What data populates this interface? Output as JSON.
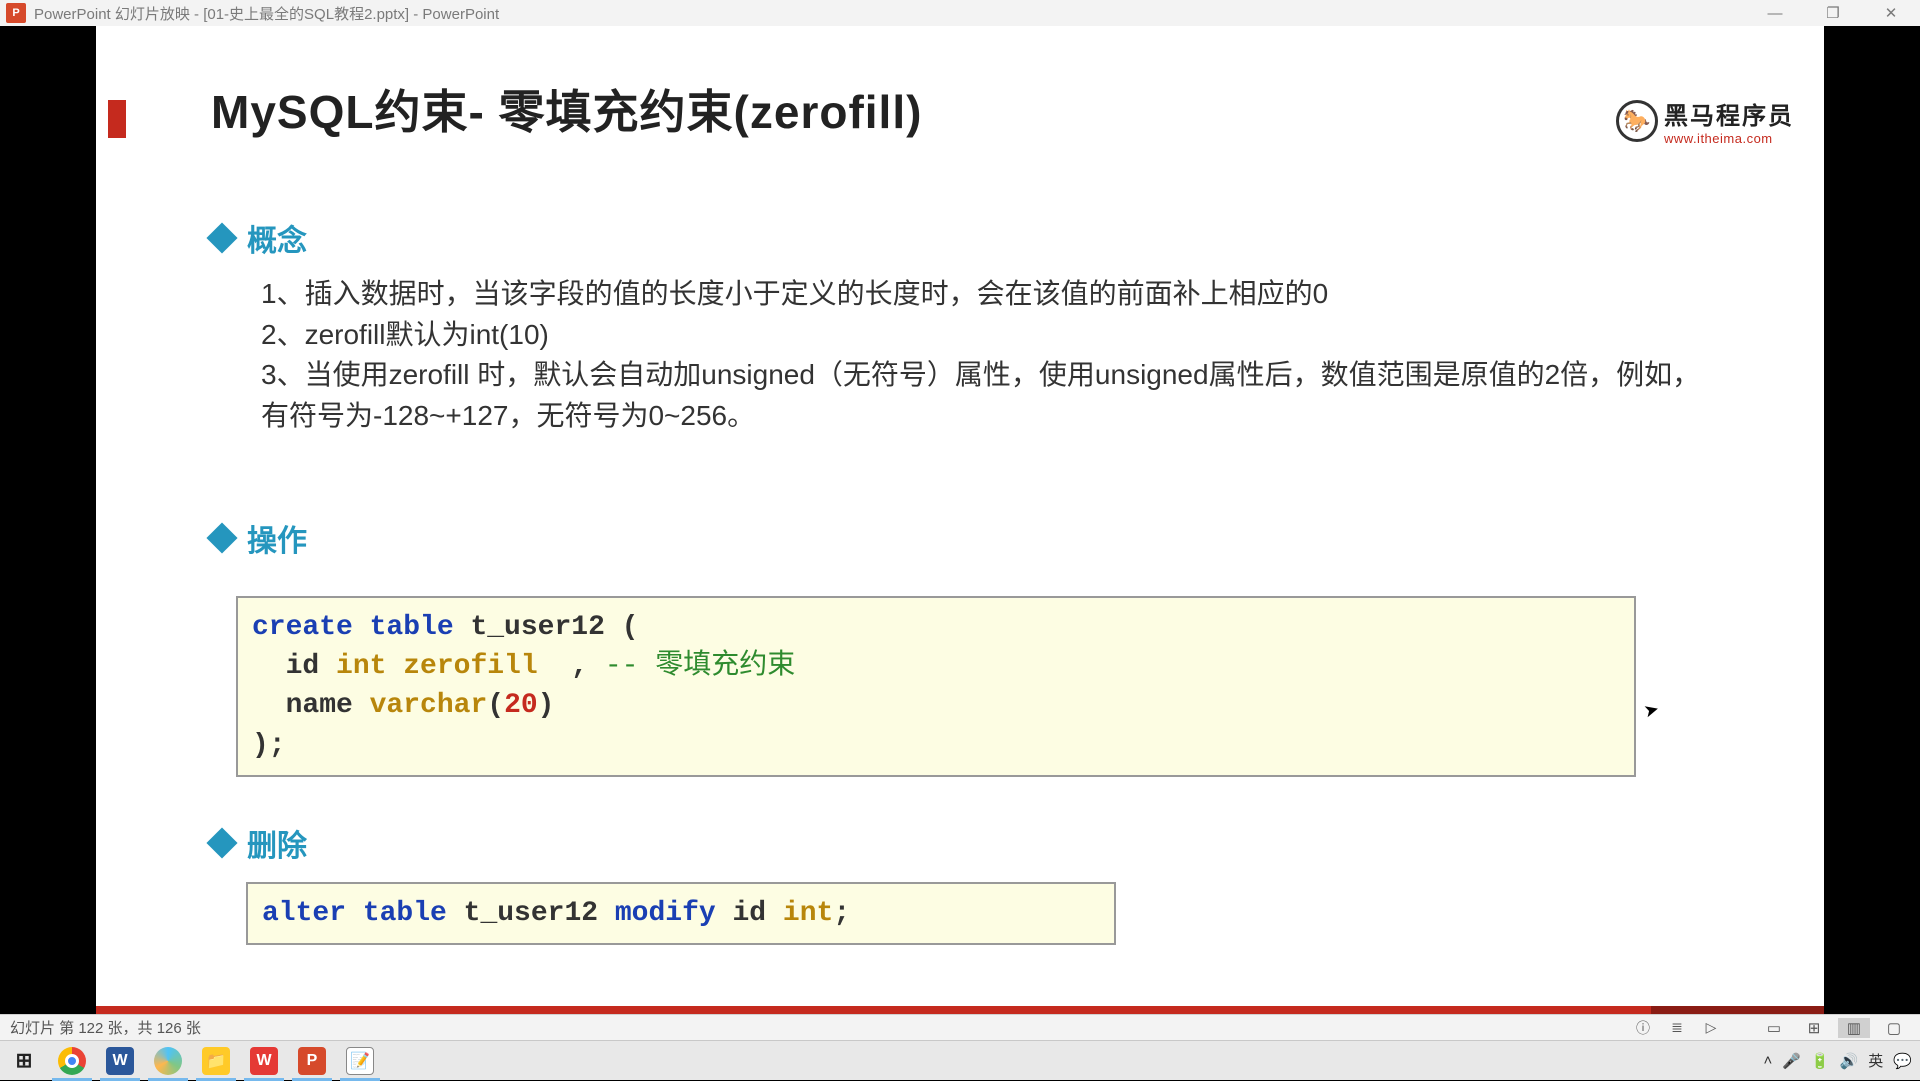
{
  "window": {
    "title": "PowerPoint 幻灯片放映 - [01-史上最全的SQL教程2.pptx] - PowerPoint",
    "minimize": "—",
    "maximize": "❐",
    "close": "✕"
  },
  "slide": {
    "title": "MySQL约束- 零填充约束(zerofill)",
    "logo": {
      "cn": "黑马程序员",
      "url": "www.itheima.com",
      "glyph": "🐎"
    },
    "section1": "概念",
    "concept_lines": [
      "1、插入数据时，当该字段的值的长度小于定义的长度时，会在该值的前面补上相应的0",
      "2、zerofill默认为int(10)",
      "3、当使用zerofill 时，默认会自动加unsigned（无符号）属性，使用unsigned属性后，数值范围是原值的2倍，例如，有符号为-128~+127，无符号为0~256。"
    ],
    "section2": "操作",
    "code1": {
      "kw1": "create table",
      "tbl": " t_user12 (",
      "l2a": "  id ",
      "l2ty": "int zerofill",
      "l2b": "  , ",
      "l2cm": "-- 零填充约束",
      "l3a": "  name ",
      "l3ty": "varchar",
      "l3b": "(",
      "l3num": "20",
      "l3c": ")  ",
      "l4": ");"
    },
    "section3": "删除",
    "code2": {
      "kw1": "alter table",
      "t1": " t_user12 ",
      "kw2": "modify",
      "t2": " id ",
      "ty": "int",
      "t3": ";"
    }
  },
  "status": {
    "left": "幻灯片 第 122 张，共 126 张"
  },
  "taskbar": {
    "start": "⊞",
    "tray_up": "˄",
    "tray_mic": "🎤",
    "tray_bat": "🔋",
    "tray_vol": "🔊",
    "tray_ime": "英",
    "tray_msg": "💬"
  }
}
